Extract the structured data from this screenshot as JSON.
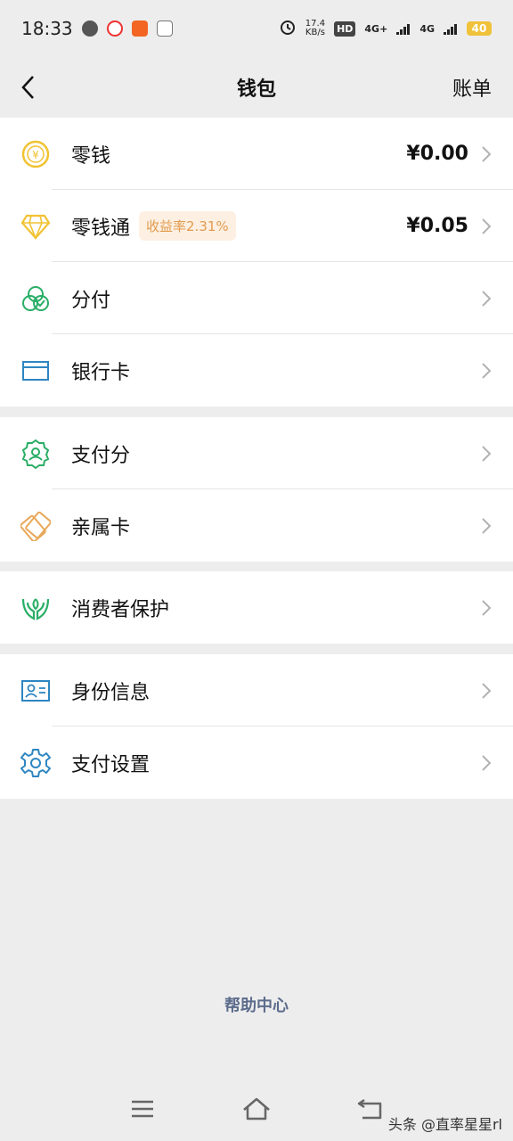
{
  "status_bar": {
    "time": "18:33",
    "speed_value": "17.4",
    "speed_unit": "KB/s",
    "hd": "HD",
    "net1": "4G+",
    "net2": "4G",
    "battery": "40"
  },
  "nav": {
    "title": "钱包",
    "right_label": "账单"
  },
  "groups": [
    {
      "items": [
        {
          "label": "零钱",
          "amount": "¥0.00",
          "icon": "coin-yuan-icon"
        },
        {
          "label": "零钱通",
          "badge": "收益率2.31%",
          "amount": "¥0.05",
          "icon": "diamond-icon"
        },
        {
          "label": "分付",
          "icon": "fenfu-icon"
        },
        {
          "label": "银行卡",
          "icon": "bank-card-icon"
        }
      ]
    },
    {
      "items": [
        {
          "label": "支付分",
          "icon": "pay-score-icon"
        },
        {
          "label": "亲属卡",
          "icon": "family-card-icon"
        }
      ]
    },
    {
      "items": [
        {
          "label": "消费者保护",
          "icon": "consumer-protection-icon"
        }
      ]
    },
    {
      "items": [
        {
          "label": "身份信息",
          "icon": "id-card-icon"
        },
        {
          "label": "支付设置",
          "icon": "settings-gear-icon"
        }
      ]
    }
  ],
  "help_center": "帮助中心",
  "watermark": "头条 @直率星星rl",
  "colors": {
    "background": "#ededed",
    "badge_bg": "#fdf0e2",
    "badge_text": "#e29b4e",
    "green_icon": "#2aae67",
    "yellow_icon": "#f1c232",
    "blue_icon": "#2e86c1",
    "orange_icon": "#e8a85a",
    "help_link": "#5c6c8c"
  }
}
